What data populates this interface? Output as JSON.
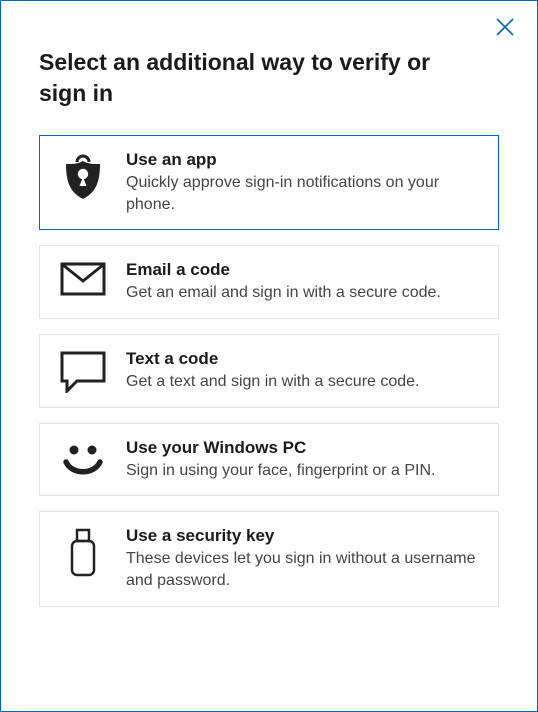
{
  "dialog": {
    "title": "Select an additional way to verify or sign in",
    "options": [
      {
        "title": "Use an app",
        "desc": "Quickly approve sign-in notifications on your phone."
      },
      {
        "title": "Email a code",
        "desc": "Get an email and sign in with a secure code."
      },
      {
        "title": "Text a code",
        "desc": "Get a text and sign in with a secure code."
      },
      {
        "title": "Use your Windows PC",
        "desc": "Sign in using your face, fingerprint or a PIN."
      },
      {
        "title": "Use a security key",
        "desc": "These devices let you sign in without a username and password."
      }
    ]
  }
}
